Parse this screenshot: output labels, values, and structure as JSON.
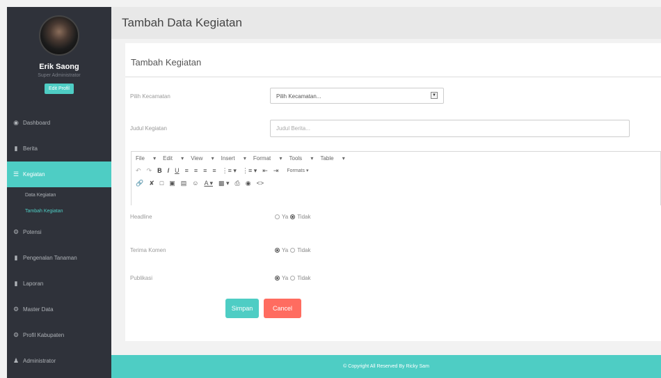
{
  "sidebar": {
    "profile": {
      "name": "Erik Saong",
      "role": "Super Administrator",
      "edit_label": "Edit Profil"
    },
    "menu": [
      {
        "label": "Dashboard",
        "icon": "dashboard-icon"
      },
      {
        "label": "Berita",
        "icon": "book-icon"
      },
      {
        "label": "Kegiatan",
        "icon": "list-icon",
        "active": true
      },
      {
        "label": "Potensi",
        "icon": "cogs-icon"
      },
      {
        "label": "Pengenalan Tanaman",
        "icon": "book-icon"
      },
      {
        "label": "Laporan",
        "icon": "book-icon"
      },
      {
        "label": "Master Data",
        "icon": "cogs-icon"
      },
      {
        "label": "Profil Kabupaten",
        "icon": "cogs-icon"
      },
      {
        "label": "Administrator",
        "icon": "user-icon"
      }
    ],
    "submenu": [
      {
        "label": "Data Kegiatan"
      },
      {
        "label": "Tambah Kegiatan",
        "current": true
      }
    ]
  },
  "header": {
    "title": "Tambah Data Kegiatan"
  },
  "panel": {
    "title": "Tambah Kegiatan",
    "kecamatan": {
      "label": "Pilih Kecamatan",
      "value": "Pilih Kecamatan..."
    },
    "judul": {
      "label": "Judul Kegiatan",
      "placeholder": "Judul Berita..."
    },
    "editor": {
      "menus": [
        "File",
        "Edit",
        "View",
        "Insert",
        "Format",
        "Tools",
        "Table"
      ],
      "formats_label": "Formats"
    },
    "headline": {
      "label": "Headline",
      "yes": "Ya",
      "no": "Tidak",
      "selected": "Tidak"
    },
    "terima_komen": {
      "label": "Terima Komen",
      "yes": "Ya",
      "no": "Tidak",
      "selected": "Ya"
    },
    "publikasi": {
      "label": "Publikasi",
      "yes": "Ya",
      "no": "Tidak",
      "selected": "Ya"
    },
    "save_label": "Simpan",
    "cancel_label": "Cancel"
  },
  "footer": {
    "text": "© Copyright All Reserved By Ricky Sam"
  },
  "colors": {
    "accent": "#4ecdc4",
    "danger": "#ff6c60",
    "sidebar": "#2f323a"
  }
}
